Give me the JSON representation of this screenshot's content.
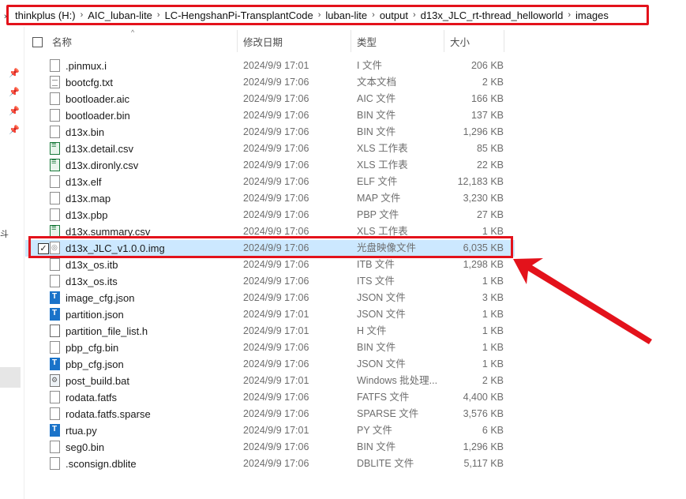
{
  "breadcrumb": [
    "thinkplus (H:)",
    "AIC_luban-lite",
    "LC-HengshanPi-TransplantCode",
    "luban-lite",
    "output",
    "d13x_JLC_rt-thread_helloworld",
    "images"
  ],
  "nav": {
    "fragment": "斗"
  },
  "columns": {
    "name": "名称",
    "date": "修改日期",
    "type": "类型",
    "size": "大小"
  },
  "files": [
    {
      "name": ".pinmux.i",
      "date": "2024/9/9 17:01",
      "type": "I 文件",
      "size": "206 KB",
      "icon": "file-icon"
    },
    {
      "name": "bootcfg.txt",
      "date": "2024/9/9 17:06",
      "type": "文本文档",
      "size": "2 KB",
      "icon": "text-file-icon"
    },
    {
      "name": "bootloader.aic",
      "date": "2024/9/9 17:06",
      "type": "AIC 文件",
      "size": "166 KB",
      "icon": "file-icon"
    },
    {
      "name": "bootloader.bin",
      "date": "2024/9/9 17:06",
      "type": "BIN 文件",
      "size": "137 KB",
      "icon": "file-icon"
    },
    {
      "name": "d13x.bin",
      "date": "2024/9/9 17:06",
      "type": "BIN 文件",
      "size": "1,296 KB",
      "icon": "file-icon"
    },
    {
      "name": "d13x.detail.csv",
      "date": "2024/9/9 17:06",
      "type": "XLS 工作表",
      "size": "85 KB",
      "icon": "spreadsheet-icon"
    },
    {
      "name": "d13x.dironly.csv",
      "date": "2024/9/9 17:06",
      "type": "XLS 工作表",
      "size": "22 KB",
      "icon": "spreadsheet-icon"
    },
    {
      "name": "d13x.elf",
      "date": "2024/9/9 17:06",
      "type": "ELF 文件",
      "size": "12,183 KB",
      "icon": "file-icon"
    },
    {
      "name": "d13x.map",
      "date": "2024/9/9 17:06",
      "type": "MAP 文件",
      "size": "3,230 KB",
      "icon": "file-icon"
    },
    {
      "name": "d13x.pbp",
      "date": "2024/9/9 17:06",
      "type": "PBP 文件",
      "size": "27 KB",
      "icon": "file-icon"
    },
    {
      "name": "d13x.summary.csv",
      "date": "2024/9/9 17:06",
      "type": "XLS 工作表",
      "size": "1 KB",
      "icon": "spreadsheet-icon"
    },
    {
      "name": "d13x_JLC_v1.0.0.img",
      "date": "2024/9/9 17:06",
      "type": "光盘映像文件",
      "size": "6,035 KB",
      "icon": "disc-image-icon",
      "selected": true
    },
    {
      "name": "d13x_os.itb",
      "date": "2024/9/9 17:06",
      "type": "ITB 文件",
      "size": "1,298 KB",
      "icon": "file-icon"
    },
    {
      "name": "d13x_os.its",
      "date": "2024/9/9 17:06",
      "type": "ITS 文件",
      "size": "1 KB",
      "icon": "file-icon"
    },
    {
      "name": "image_cfg.json",
      "date": "2024/9/9 17:06",
      "type": "JSON 文件",
      "size": "3 KB",
      "icon": "json-file-icon"
    },
    {
      "name": "partition.json",
      "date": "2024/9/9 17:01",
      "type": "JSON 文件",
      "size": "1 KB",
      "icon": "json-file-icon"
    },
    {
      "name": "partition_file_list.h",
      "date": "2024/9/9 17:01",
      "type": "H 文件",
      "size": "1 KB",
      "icon": "code-file-icon"
    },
    {
      "name": "pbp_cfg.bin",
      "date": "2024/9/9 17:06",
      "type": "BIN 文件",
      "size": "1 KB",
      "icon": "file-icon"
    },
    {
      "name": "pbp_cfg.json",
      "date": "2024/9/9 17:06",
      "type": "JSON 文件",
      "size": "1 KB",
      "icon": "json-file-icon"
    },
    {
      "name": "post_build.bat",
      "date": "2024/9/9 17:01",
      "type": "Windows 批处理...",
      "size": "2 KB",
      "icon": "batch-file-icon"
    },
    {
      "name": "rodata.fatfs",
      "date": "2024/9/9 17:06",
      "type": "FATFS 文件",
      "size": "4,400 KB",
      "icon": "file-icon"
    },
    {
      "name": "rodata.fatfs.sparse",
      "date": "2024/9/9 17:06",
      "type": "SPARSE 文件",
      "size": "3,576 KB",
      "icon": "file-icon"
    },
    {
      "name": "rtua.py",
      "date": "2024/9/9 17:01",
      "type": "PY 文件",
      "size": "6 KB",
      "icon": "json-file-icon"
    },
    {
      "name": "seg0.bin",
      "date": "2024/9/9 17:06",
      "type": "BIN 文件",
      "size": "1,296 KB",
      "icon": "file-icon"
    },
    {
      "name": ".sconsign.dblite",
      "date": "2024/9/9 17:06",
      "type": "DBLITE 文件",
      "size": "5,117 KB",
      "icon": "file-icon"
    }
  ],
  "colors": {
    "highlight": "#e3121b",
    "selection": "#cce8ff"
  }
}
